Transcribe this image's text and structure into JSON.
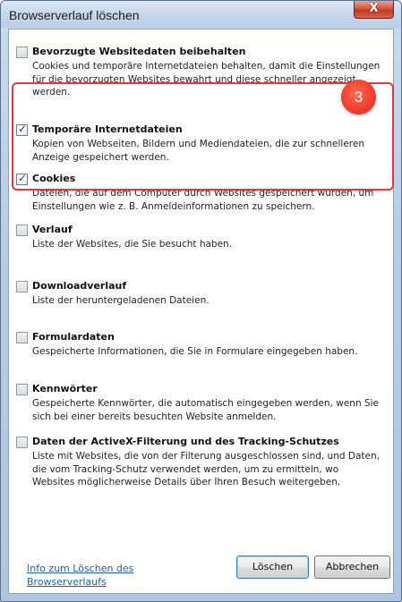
{
  "window": {
    "title": "Browserverlauf löschen",
    "close_glyph": "X"
  },
  "options": [
    {
      "title": "Bevorzugte Websitedaten beibehalten",
      "checked": false,
      "desc": "Cookies und temporäre Internetdateien behalten, damit die Einstellungen für die bevorzugten Websites bewahrt und diese schneller angezeigt werden."
    },
    {
      "title": "Temporäre Internetdateien",
      "checked": true,
      "desc": "Kopien von Webseiten, Bildern und Mediendateien, die zur schnelleren Anzeige gespeichert werden."
    },
    {
      "title": "Cookies",
      "checked": true,
      "desc": "Dateien, die auf dem Computer durch Websites gespeichert wurden, um Einstellungen wie z. B. Anmeldeinformationen zu speichern."
    },
    {
      "title": "Verlauf",
      "checked": false,
      "desc": "Liste der Websites, die Sie besucht haben."
    },
    {
      "title": "Downloadverlauf",
      "checked": false,
      "desc": "Liste der heruntergeladenen Dateien."
    },
    {
      "title": "Formulardaten",
      "checked": false,
      "desc": "Gespeicherte Informationen, die Sie in Formulare eingegeben haben."
    },
    {
      "title": "Kennwörter",
      "checked": false,
      "desc": "Gespeicherte Kennwörter, die automatisch eingegeben werden, wenn Sie sich bei einer bereits besuchten Website anmelden."
    },
    {
      "title": "Daten der ActiveX-Filterung und des Tracking-Schutzes",
      "checked": false,
      "desc": "Liste mit Websites, die von der Filterung ausgeschlossen sind, und Daten, die vom Tracking-Schutz verwendet werden, um zu ermitteln, wo Websites möglicherweise Details über Ihren Besuch weitergeben."
    }
  ],
  "annotation": {
    "badge_number": "3",
    "color": "#e53935"
  },
  "footer": {
    "info_link": "Info zum Löschen des Browserverlaufs",
    "delete_button": "Löschen",
    "cancel_button": "Abbrechen"
  },
  "icons": {
    "checkmark": "checkmark-icon",
    "close": "close-icon"
  }
}
